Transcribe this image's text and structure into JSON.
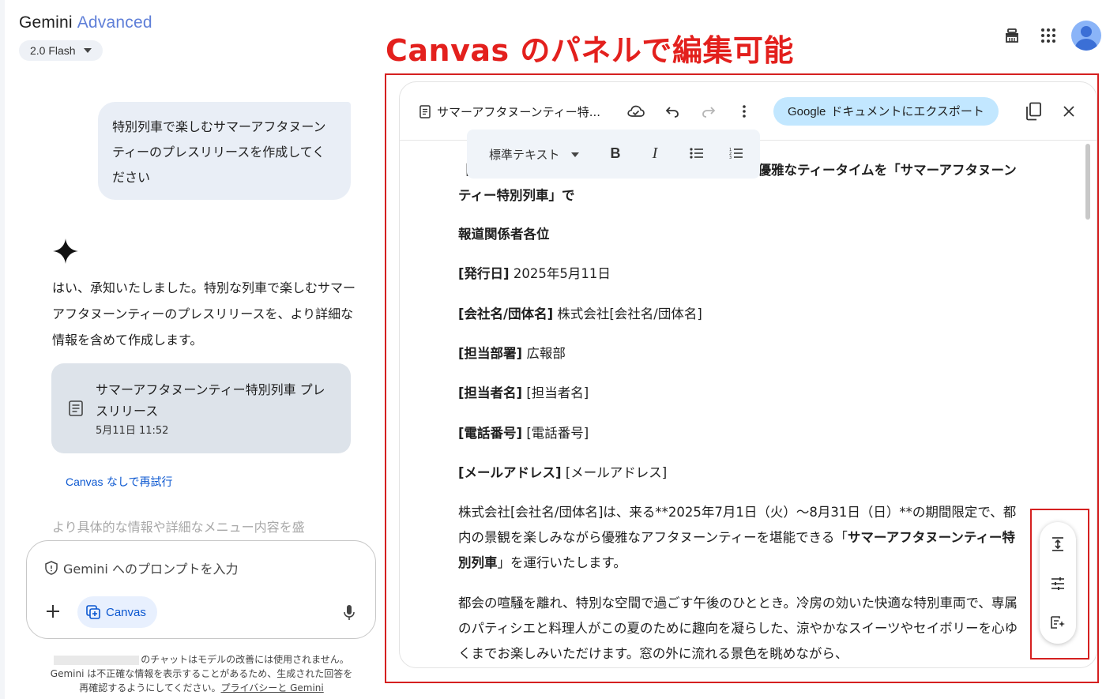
{
  "sidebar": {
    "brand": "Gemini",
    "brand_tier": "Advanced",
    "model": "2.0 Flash"
  },
  "chat": {
    "user_message": "特別列車で楽しむサマーアフタヌーンティーのプレスリリースを作成してください",
    "reply": "はい、承知いたしました。特別な列車で楽しむサマーアフタヌーンティーのプレスリリースを、より詳細な情報を含めて作成します。",
    "doc_card": {
      "title": "サマーアフタヌーンティー特別列車 プレスリリース",
      "time": "5月11日 11:52"
    },
    "retry_prefix": "Canvas",
    "retry_suffix": " なしで再試行",
    "faded_text": "より具体的な情報や詳細なメニュー内容を盛"
  },
  "prompt": {
    "placeholder": "Gemini へのプロンプトを入力",
    "canvas_label": "Canvas"
  },
  "disclaimer": {
    "line1": "のチャットはモデルの改善には使用されません。",
    "line2": "Gemini は不正確な情報を表示することがあるため、生成された回答を",
    "line3": "再確認するようにしてください。",
    "link": "プライバシーと Gemini"
  },
  "annotation": {
    "headline": "Canvas のパネルで編集可能"
  },
  "canvas": {
    "doc_title": "サマーアフタヌーンティー特...",
    "export_g": "Google",
    "export_rest": "ドキュメントにエクスポート",
    "format_style": "標準テキスト",
    "bold_label": "B",
    "italic_label": "I",
    "body": {
      "p1": "【都内を巡る特別な午後の旅】涼やかな夏の彩りと優雅なティータイムを「サマーアフタヌーンティー特別列車」で",
      "p2": "報道関係者各位",
      "p3_label": "[発行日]",
      "p3_value": " 2025年5月11日",
      "p4_label": "[会社名/団体名]",
      "p4_value": " 株式会社[会社名/団体名]",
      "p5_label": "[担当部署]",
      "p5_value": " 広報部",
      "p6_label": "[担当者名]",
      "p6_value": " [担当者名]",
      "p7_label": "[電話番号]",
      "p7_value": " [電話番号]",
      "p8_label": "[メールアドレス]",
      "p8_value": " [メールアドレス]",
      "p9_a": "株式会社[会社名/団体名]は、来る**2025年7月1日（火）〜8月31日（日）**の期間限定で、都内の景観を楽しみながら優雅なアフタヌーンティーを堪能できる「",
      "p9_b": "サマーアフタヌーンティー特別列車",
      "p9_c": "」を運行いたします。",
      "p10": "都会の喧騒を離れ、特別な空間で過ごす午後のひととき。冷房の効いた快適な特別車両で、専属のパティシエと料理人がこの夏のために趣向を凝らした、涼やかなスイーツやセイボリーを心ゆくまでお楽しみいただけます。窓の外に流れる景色を眺めながら、"
    }
  },
  "colors": {
    "annotation_red": "#e3201d",
    "link_blue": "#0b57d0",
    "export_bg": "#c2e7ff",
    "user_bubble": "#e9eef6",
    "doc_card": "#dde3ea"
  }
}
